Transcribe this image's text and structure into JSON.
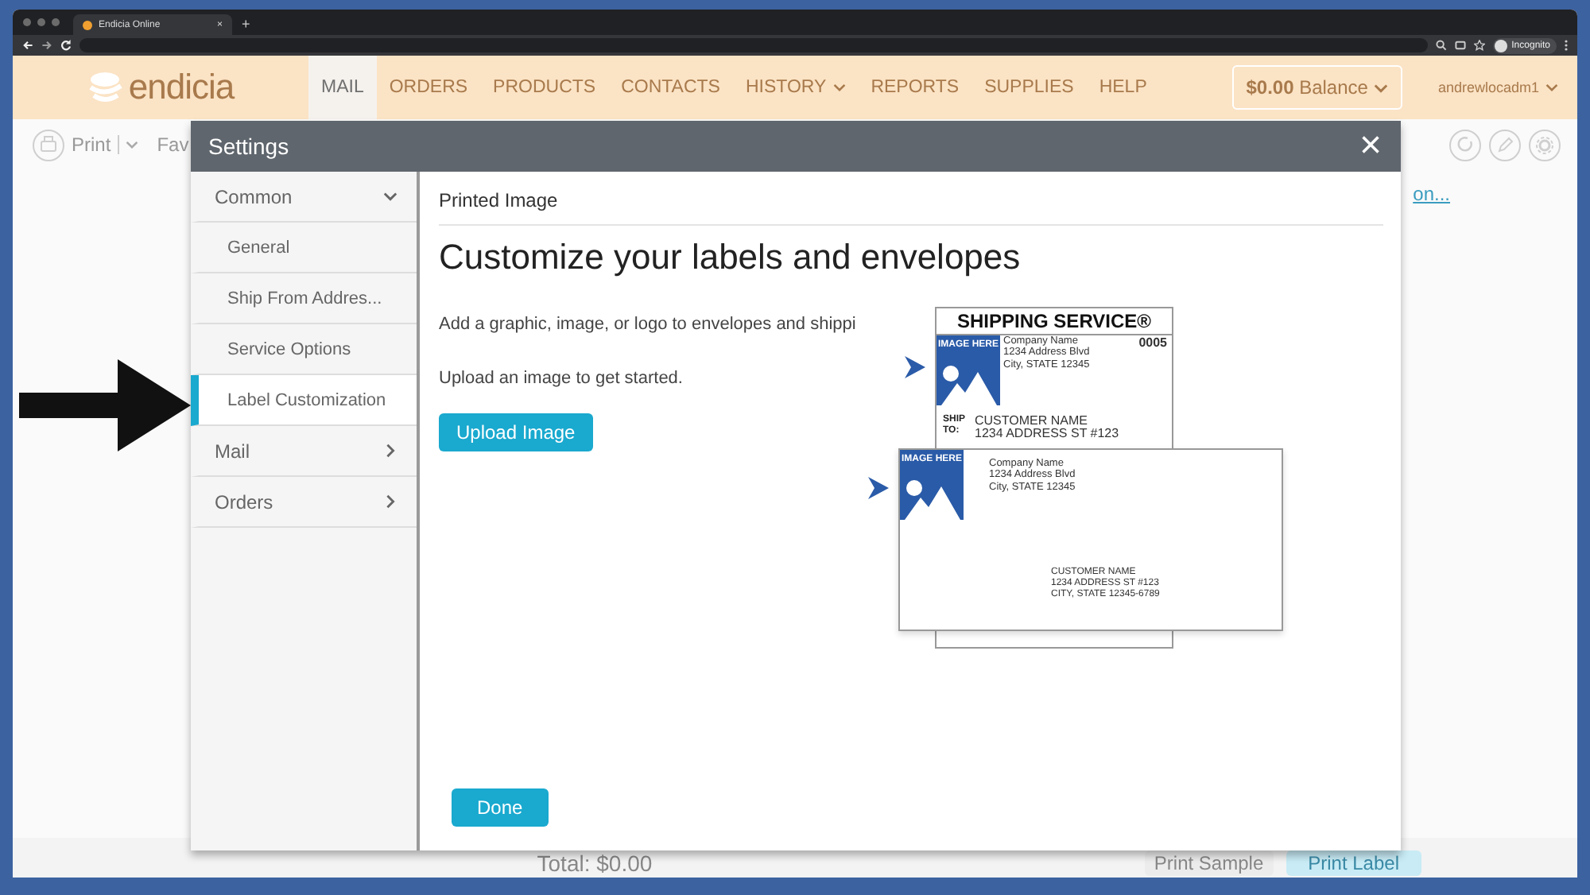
{
  "browser": {
    "tab_title": "Endicia Online",
    "tab_close": "×",
    "new_tab": "+",
    "profile": "Incognito"
  },
  "app_header": {
    "logo": "endicia",
    "nav": [
      {
        "label": "MAIL",
        "selected": true,
        "has_menu": false
      },
      {
        "label": "ORDERS",
        "selected": false,
        "has_menu": false
      },
      {
        "label": "PRODUCTS",
        "selected": false,
        "has_menu": false
      },
      {
        "label": "CONTACTS",
        "selected": false,
        "has_menu": false
      },
      {
        "label": "HISTORY",
        "selected": false,
        "has_menu": true
      },
      {
        "label": "REPORTS",
        "selected": false,
        "has_menu": false
      },
      {
        "label": "SUPPLIES",
        "selected": false,
        "has_menu": false
      },
      {
        "label": "HELP",
        "selected": false,
        "has_menu": false
      }
    ],
    "balance": "**$0.00** Balance",
    "user": "andrewlocadm1"
  },
  "toolbar": {
    "print": "Print",
    "favorites": "Fav",
    "link": "on..."
  },
  "footer": {
    "total": "Total: $0.00",
    "buttons": [
      {
        "label": "Print Sample",
        "kind": "secondary"
      },
      {
        "label": "Print Label",
        "kind": "primary"
      }
    ]
  },
  "settings_dialog": {
    "title": "Settings",
    "close": "×",
    "sidebar": [
      {
        "label": "Common",
        "selected": false,
        "expanded": true,
        "children": [
          {
            "label": "General",
            "selected": false
          },
          {
            "label": "Ship From Addres...",
            "selected": false
          },
          {
            "label": "Service Options",
            "selected": false
          },
          {
            "label": "Label Customization",
            "selected": true
          }
        ]
      },
      {
        "label": "Mail",
        "selected": false,
        "expanded": false
      },
      {
        "label": "Orders",
        "selected": false,
        "expanded": false
      }
    ],
    "section_title": "Printed Image",
    "heading": "Customize your labels and envelopes",
    "description": "Add a graphic, image, or logo to envelopes and shippi",
    "instruction": "Upload an image to get started.",
    "upload_button": "Upload Image",
    "done_button": "Done",
    "preview": {
      "label": {
        "service": "SHIPPING SERVICE®",
        "image_text": "IMAGE HERE",
        "sender": [
          "Company Name",
          "1234 Address Blvd",
          "City, STATE 12345"
        ],
        "number": "0005",
        "ship_to": "SHIP TO:",
        "recipient": [
          "CUSTOMER NAME",
          "1234 ADDRESS ST #123"
        ]
      },
      "envelope": {
        "image_text": "IMAGE HERE",
        "sender": [
          "Company Name",
          "1234 Address Blvd",
          "City, STATE 12345"
        ],
        "recipient": [
          "CUSTOMER NAME",
          "1234 ADDRESS ST #123",
          "CITY, STATE 12345-6789"
        ]
      }
    }
  }
}
